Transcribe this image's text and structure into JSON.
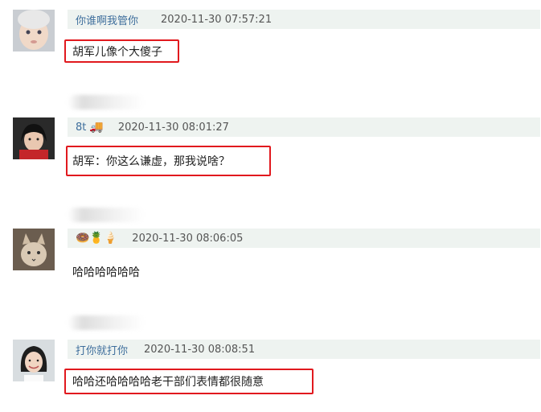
{
  "comments": [
    {
      "username": "你谁啊我管你",
      "timestamp": "2020-11-30 07:57:21",
      "text": "胡军儿像个大傻子",
      "highlighted": true,
      "avatar": "baby-portrait"
    },
    {
      "username": "8t",
      "username_emoji": "🚚",
      "timestamp": "2020-11-30 08:01:27",
      "text": "胡军：你这么谦虚，那我说啥？",
      "highlighted": true,
      "avatar": "woman-dark-hair-portrait"
    },
    {
      "username_emojis": "🍩🍍🍦",
      "timestamp": "2020-11-30 08:06:05",
      "text": "哈哈哈哈哈哈",
      "highlighted": false,
      "avatar": "cat-portrait"
    },
    {
      "username": "打你就打你",
      "timestamp": "2020-11-30 08:08:51",
      "text": "哈哈还哈哈哈哈老干部们表情都很随意",
      "highlighted": true,
      "avatar": "smiling-woman-portrait"
    }
  ],
  "colors": {
    "highlight": "#e1191e",
    "header_bg": "#eef3f0",
    "username": "#3e6e9c"
  }
}
